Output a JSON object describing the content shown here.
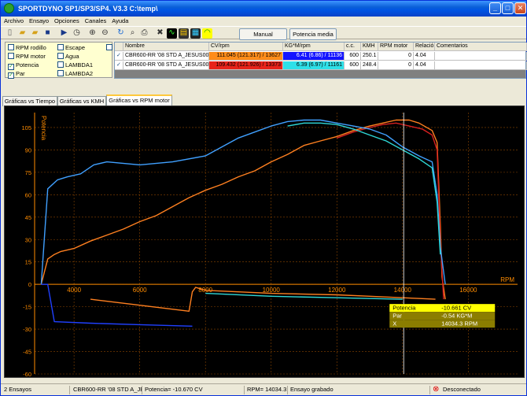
{
  "window": {
    "title": "SPORTDYNO SP1/SP3/SP4.  V3.3  C:\\temp\\"
  },
  "menu": [
    "Archivo",
    "Ensayo",
    "Opciones",
    "Canales",
    "Ayuda"
  ],
  "toolbar": {
    "icons": [
      "new-file-icon",
      "open-folder-icon",
      "open-folder-2-icon",
      "save-icon",
      "play-icon",
      "clock-icon",
      "zoom-in-icon",
      "zoom-out-icon",
      "refresh-icon",
      "search-icon",
      "print-icon",
      "tools-icon",
      "chart-icon",
      "calculator-icon",
      "display-icon",
      "gauge-icon"
    ],
    "manual_label": "Manual",
    "potencia_media_label": "Potencia media"
  },
  "channels": [
    {
      "label": "RPM rodillo",
      "checked": false
    },
    {
      "label": "RPM motor",
      "checked": false
    },
    {
      "label": "Potencia",
      "checked": true
    },
    {
      "label": "Par",
      "checked": true
    },
    {
      "label": "Escape",
      "checked": false
    },
    {
      "label": "Agua",
      "checked": false
    },
    {
      "label": "LAMBDA1",
      "checked": false
    },
    {
      "label": "LAMBDA2",
      "checked": false
    }
  ],
  "grid": {
    "headers": [
      "Nombre",
      "CV/rpm",
      "KG*M/rpm",
      "c.c.",
      "KMH",
      "RPM motor",
      "Relació",
      "Comentarios"
    ],
    "rows": [
      {
        "name": "CBR600-RR  '08 STD A_JESUS00",
        "cv": "111.045 (121.317) / 13627",
        "kgm": "6.41 (6.86) / 11136",
        "cc": "600",
        "kmh": "250.1",
        "rpm": "0",
        "rel": "4.04",
        "com": "",
        "cv_color": "#ff8c1a",
        "kgm_color": "#1414ff"
      },
      {
        "name": "CBR600-RR  '08 STD A_JESUS00",
        "cv": "109.432 (121.926) / 13373",
        "kgm": "6.39 (6.97) / 11161",
        "cc": "600",
        "kmh": "248.4",
        "rpm": "0",
        "rel": "4.04",
        "com": "",
        "cv_color": "#e8231a",
        "kgm_color": "#2ee0e8"
      }
    ]
  },
  "tabs": [
    "Gráficas vs Tiempo",
    "Gráficas vs KMH",
    "Gráficas vs RPM motor"
  ],
  "active_tab": 2,
  "tooltip": {
    "rows": [
      {
        "label": "Potencia",
        "value": "-10.661 CV"
      },
      {
        "label": "Par",
        "value": "-0.54 KG*M"
      },
      {
        "label": "X",
        "value": "14034.3 RPM"
      }
    ]
  },
  "status": {
    "ensayos": "2 Ensayos",
    "name": "CBR600-RR  '08 STD A_JE",
    "potencia": "Potencia= -10.670 CV",
    "rpm": "RPM= 14034.3",
    "state": "Ensayo grabado",
    "connection": "Desconectado"
  },
  "chart_data": {
    "type": "line",
    "xlabel": "RPM",
    "ylabel": "Potencia",
    "xlim": [
      2800,
      17500
    ],
    "ylim": [
      -60,
      115
    ],
    "xticks": [
      4000,
      6000,
      8000,
      10000,
      12000,
      14000,
      16000
    ],
    "yticks": [
      -60,
      -45,
      -30,
      -15,
      0,
      15,
      30,
      45,
      60,
      75,
      90,
      105
    ],
    "cursor_x": 14034.3,
    "colors": {
      "axes": "#ff8c00",
      "grid": "#8b4500",
      "cursor": "#ffffff"
    },
    "series": [
      {
        "color": "#ff8020",
        "x": [
          3000,
          3200,
          3400,
          3600,
          4000,
          4500,
          5000,
          5500,
          6000,
          6500,
          7000,
          7500,
          8000,
          8500,
          9000,
          9500,
          10000,
          10500,
          11000,
          11500,
          12000,
          12500,
          13000,
          13400,
          13800,
          14200,
          14500,
          14900,
          15050,
          15150,
          15200,
          15300
        ],
        "y": [
          0,
          17,
          20,
          22,
          24,
          29,
          33,
          37,
          42,
          46,
          52,
          58,
          63,
          67,
          72,
          76,
          82,
          87,
          93,
          96,
          99,
          103,
          106,
          108,
          110,
          110,
          108,
          103,
          95,
          40,
          5,
          -10
        ]
      },
      {
        "color": "#d72020",
        "x": [
          12000,
          12500,
          13000,
          13400,
          13800,
          14200,
          14600,
          14900,
          15050,
          15150,
          15250
        ],
        "y": [
          98,
          102,
          105,
          107,
          108,
          106,
          104,
          100,
          90,
          30,
          -10
        ]
      },
      {
        "color": "#40a0ff",
        "x": [
          3000,
          3200,
          3500,
          3800,
          4200,
          4600,
          5000,
          6000,
          7000,
          8000,
          8500,
          9000,
          9500,
          10000,
          10500,
          11000,
          11500,
          12000,
          12500,
          13000,
          13500,
          14000,
          14500,
          14900,
          15050,
          15150,
          15300
        ],
        "y": [
          0,
          64,
          70,
          72,
          74,
          80,
          82,
          80,
          82,
          86,
          92,
          98,
          102,
          106,
          109,
          110,
          110,
          108,
          106,
          104,
          100,
          92,
          86,
          82,
          60,
          25,
          0
        ]
      },
      {
        "color": "#2ed8d8",
        "x": [
          10500,
          11000,
          11500,
          12000,
          12500,
          13000,
          13500,
          14000,
          14500,
          14900,
          15050,
          15150
        ],
        "y": [
          106,
          108,
          108,
          107,
          104,
          100,
          96,
          90,
          84,
          78,
          55,
          20
        ]
      },
      {
        "color": "#ff8020",
        "x": [
          4500,
          6000,
          7500,
          7600,
          7700,
          8000,
          10000,
          12000,
          13000,
          14000,
          15000
        ],
        "y": [
          -10,
          -14,
          -18,
          -5,
          -2,
          -4,
          -6,
          -7,
          -8,
          -9,
          -10
        ]
      },
      {
        "color": "#2040ff",
        "x": [
          3000,
          3200,
          3400,
          4500,
          6000,
          7600
        ],
        "y": [
          0,
          0,
          -25,
          -26,
          -27,
          -28
        ]
      },
      {
        "color": "#2ed8d8",
        "x": [
          8000,
          10000,
          12000,
          14000
        ],
        "y": [
          -6,
          -8,
          -9,
          -10
        ]
      }
    ]
  }
}
